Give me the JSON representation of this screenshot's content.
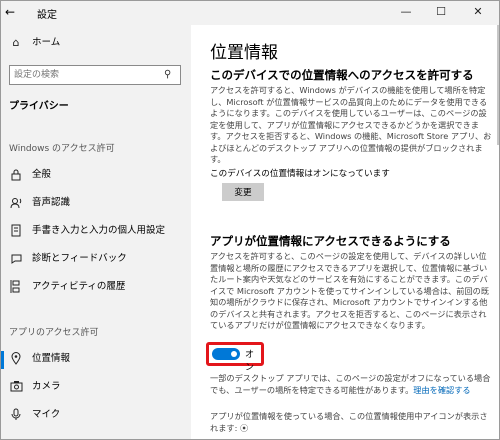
{
  "window": {
    "back_glyph": "←",
    "title": "設定",
    "controls": {
      "minimize": "—",
      "maximize": "☐",
      "close": "✕"
    }
  },
  "sidebar": {
    "home": "ホーム",
    "search_placeholder": "設定の検索",
    "section_title": "プライバシー",
    "group_windows": "Windows のアクセス許可",
    "windows_items": [
      {
        "icon": "lock-icon",
        "label": "全般"
      },
      {
        "icon": "speech-icon",
        "label": "音声認識"
      },
      {
        "icon": "notebook-icon",
        "label": "手書き入力と入力の個人用設定"
      },
      {
        "icon": "diagnostics-icon",
        "label": "診断とフィードバック"
      },
      {
        "icon": "timeline-icon",
        "label": "アクティビティの履歴"
      }
    ],
    "group_apps": "アプリのアクセス許可",
    "app_items": [
      {
        "icon": "location-icon",
        "label": "位置情報",
        "selected": true
      },
      {
        "icon": "camera-icon",
        "label": "カメラ"
      },
      {
        "icon": "microphone-icon",
        "label": "マイク"
      }
    ]
  },
  "main": {
    "title": "位置情報",
    "device_section": {
      "heading": "このデバイスでの位置情報へのアクセスを許可する",
      "description": "アクセスを許可すると、Windows がデバイスの機能を使用して場所を特定し、Microsoft が位置情報サービスの品質向上のためにデータを使用できるようになります。このデバイスを使用しているユーザーは、このページの設定を使用して、アプリが位置情報にアクセスできるかどうかを選択できます。アクセスを拒否すると、Windows の機能、Microsoft Store アプリ、およびほとんどのデスクトップ アプリへの位置情報の提供がブロックされます。",
      "status": "このデバイスの位置情報はオンになっています",
      "change_button": "変更"
    },
    "apps_section": {
      "heading": "アプリが位置情報にアクセスできるようにする",
      "description": "アクセスを許可すると、このページの設定を使用して、デバイスの詳しい位置情報と場所の履歴にアクセスできるアプリを選択して、位置情報に基づいたルート案内や天気などのサービスを有効にすることができます。このデバイスで Microsoft アカウントを使ってサインインしている場合は、前回の既知の場所がクラウドに保存され、Microsoft アカウントでサインインする他のデバイスと共有されます。アクセスを拒否すると、このページに表示されているアプリだけが位置情報にアクセスできなくなります。",
      "toggle_state": "オン",
      "toggle_on": true,
      "note": "一部のデスクトップ アプリでは、このページの設定がオフになっている場合でも、ユーザーの場所を特定できる可能性があります。",
      "note_link": "理由を確認する",
      "footer": "アプリが位置情報を使っている場合、この位置情報使用中アイコンが表示されます:",
      "footer_icon": "⦿"
    },
    "accent_color": "#0078d7",
    "highlight_color": "#e3161b"
  }
}
